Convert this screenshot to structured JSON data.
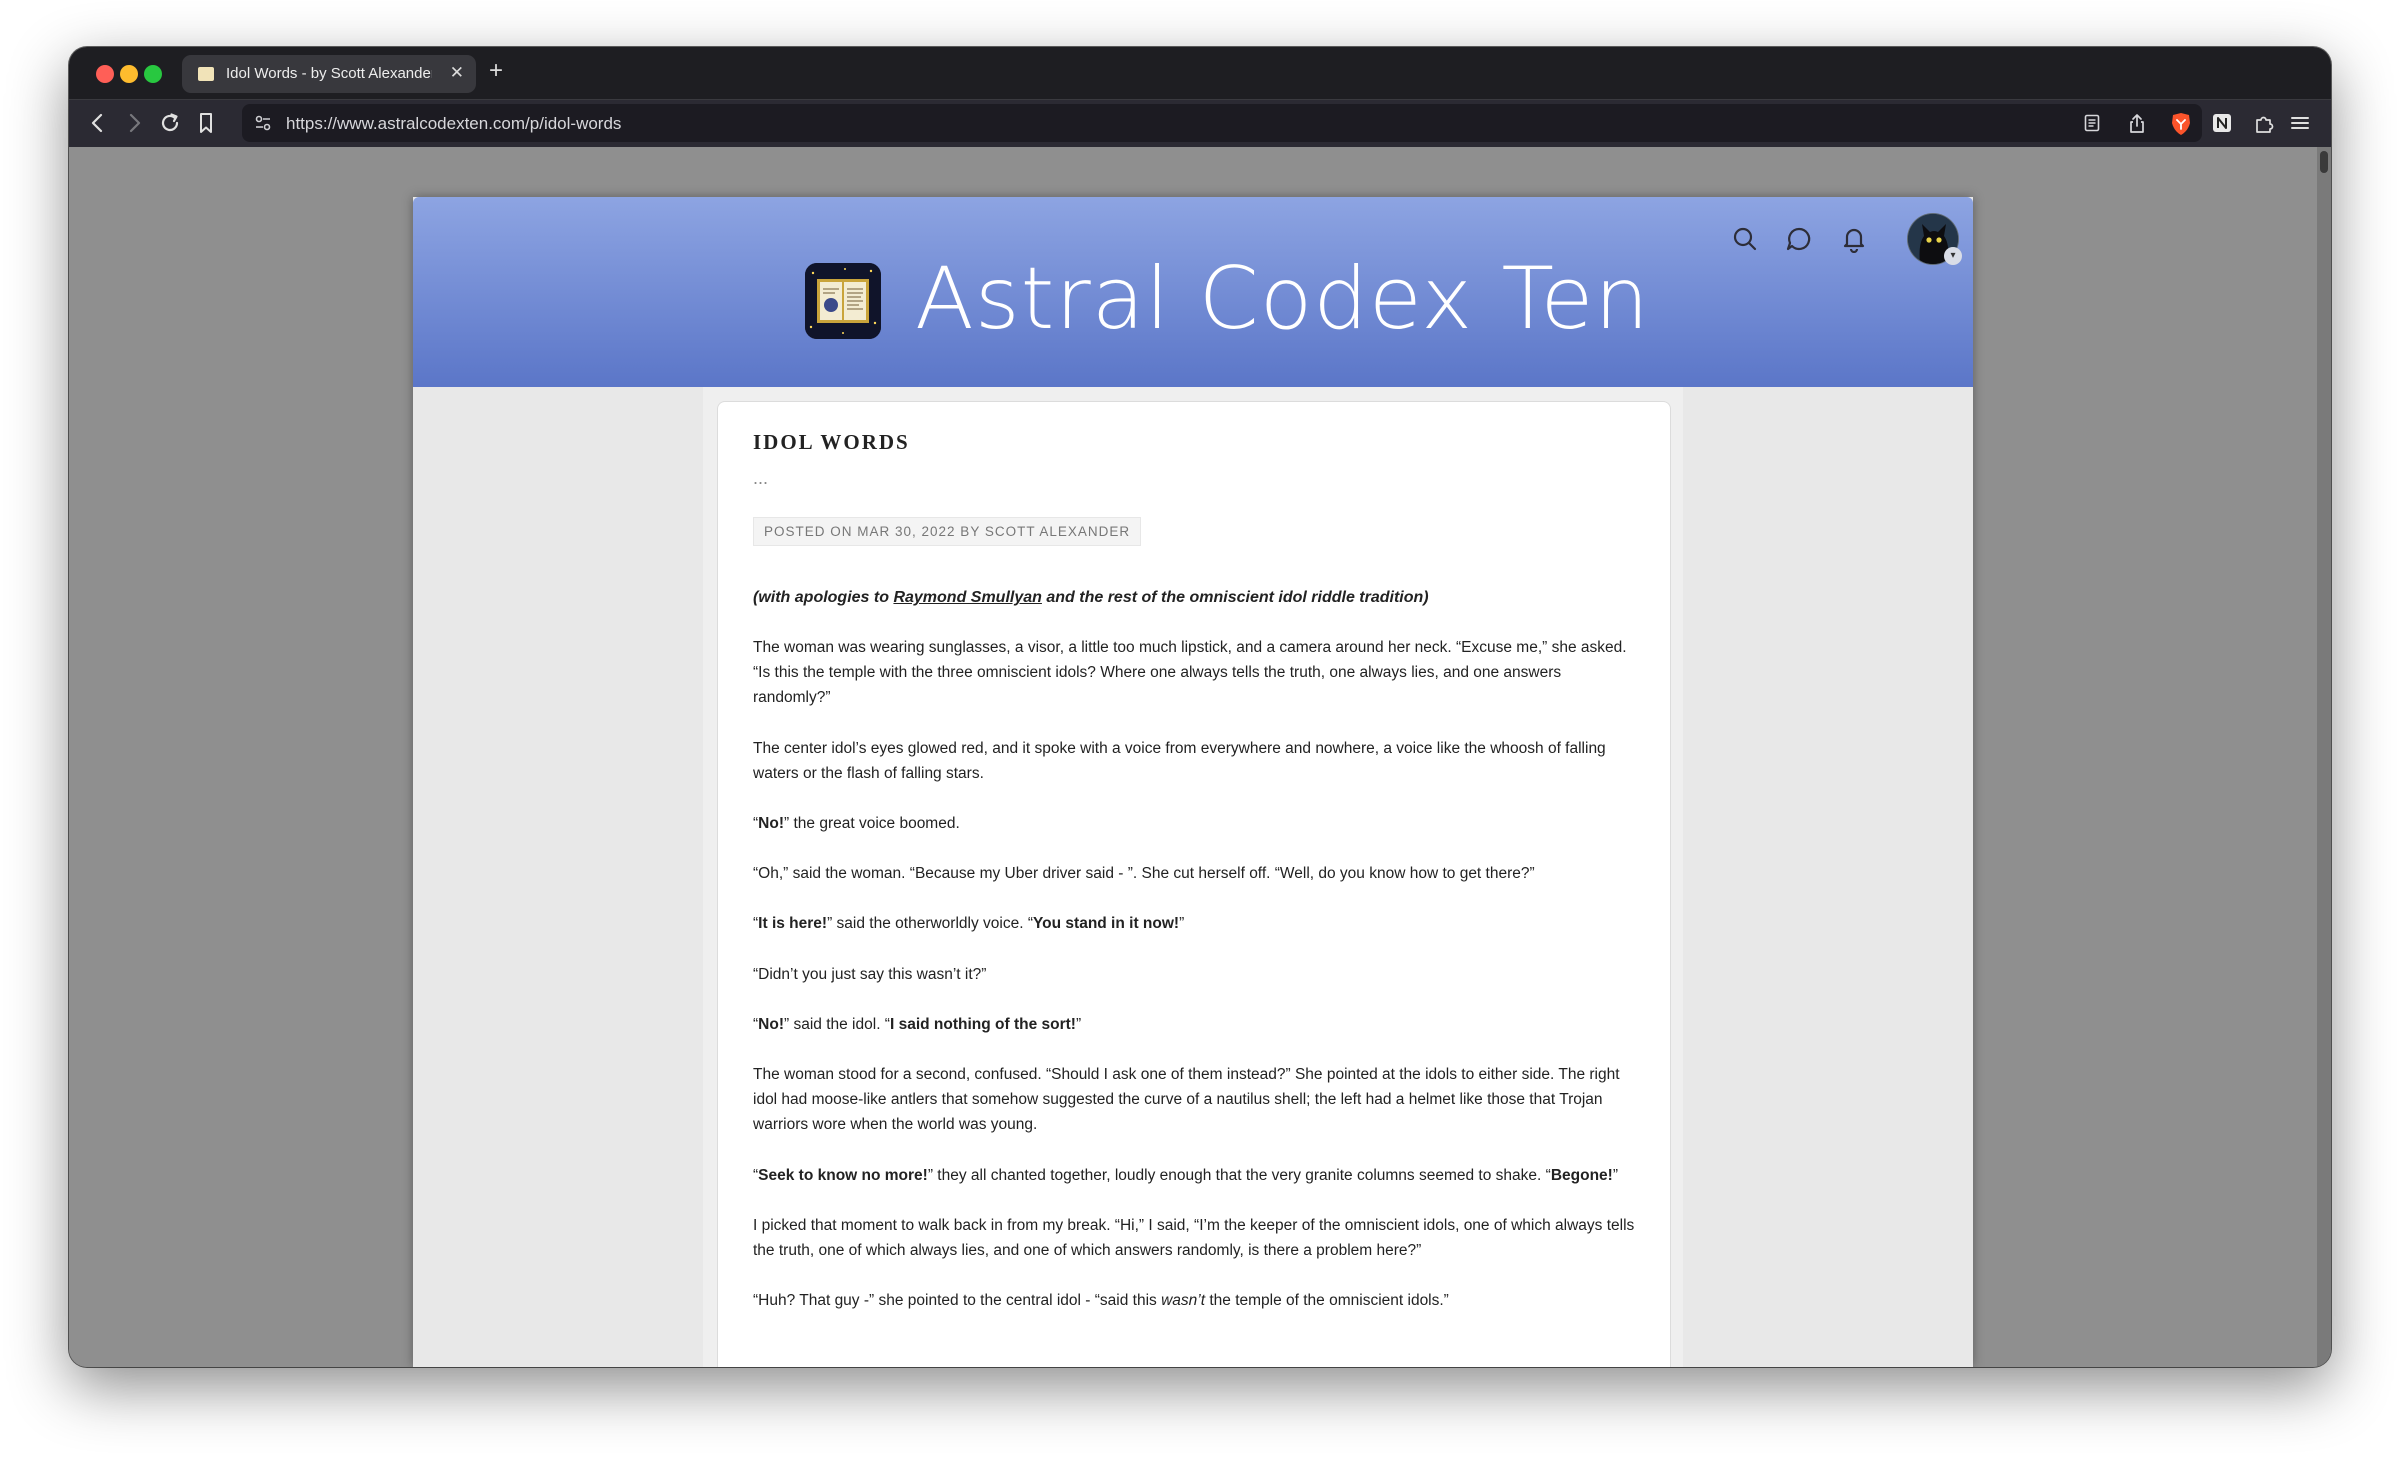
{
  "browser": {
    "tab_title": "Idol Words - by Scott Alexander",
    "new_tab_label": "+",
    "close_label": "✕",
    "url": "https://www.astralcodexten.com/p/idol-words"
  },
  "site": {
    "title": "Astral Codex Ten"
  },
  "post": {
    "title": "IDOL WORDS",
    "ellipsis": "...",
    "meta": "POSTED ON MAR 30, 2022 BY SCOTT ALEXANDER",
    "intro": {
      "before": "(with apologies to ",
      "link": "Raymond Smullyan",
      "after": " and the rest of the omniscient idol riddle tradition)"
    },
    "p1": "The woman was wearing sunglasses, a visor, a little too much lipstick, and a camera around her neck. “Excuse me,” she asked. “Is this the temple with the three omniscient idols? Where one always tells the truth, one always lies, and one answers randomly?”",
    "p2": "The center idol’s eyes glowed red, and it spoke with a voice from everywhere and nowhere, a voice like the whoosh of falling waters or the flash of falling stars.",
    "p3": {
      "q1": "“",
      "b1": "No!",
      "t1": "” the great voice boomed."
    },
    "p4": "“Oh,” said the woman. “Because my Uber driver said - ”. She cut herself off. “Well, do you know how to get there?”",
    "p5": {
      "q1": "“",
      "b1": "It is here!",
      "t1": "” said the otherworldly voice. “",
      "b2": "You stand in it now!",
      "t2": "”"
    },
    "p6": "“Didn’t you just say this wasn’t it?”",
    "p7": {
      "q1": "“",
      "b1": "No!",
      "t1": "” said the idol. “",
      "b2": "I said nothing of the sort!",
      "t2": "”"
    },
    "p8": "The woman stood for a second, confused. “Should I ask one of them instead?” She pointed at the idols to either side. The right idol had moose-like antlers that somehow suggested the curve of a nautilus shell; the left had a helmet like those that Trojan warriors wore when the world was young.",
    "p9": {
      "q1": "“",
      "b1": "Seek to know no more!",
      "t1": "” they all chanted together, loudly enough that the very granite columns seemed to shake. “",
      "b2": "Begone!",
      "t2": "”"
    },
    "p10": "I picked that moment to walk back in from my break. “Hi,” I said, “I’m the keeper of the omniscient idols, one of which always tells the truth, one of which always lies, and one of which answers randomly, is there a problem here?”",
    "p11": {
      "t1": "“Huh? That guy -” she pointed to the central idol - “said this ",
      "i1": "wasn’t",
      "t2": " the temple of the omniscient idols.”"
    }
  }
}
